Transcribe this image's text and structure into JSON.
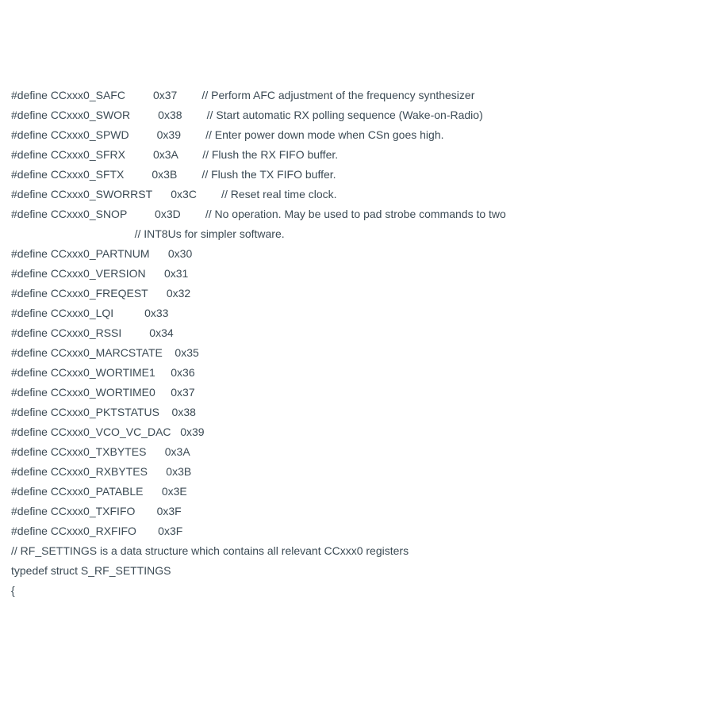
{
  "lines": [
    "#define CCxxx0_SAFC         0x37        // Perform AFC adjustment of the frequency synthesizer",
    "#define CCxxx0_SWOR         0x38        // Start automatic RX polling sequence (Wake-on-Radio)",
    "#define CCxxx0_SPWD         0x39        // Enter power down mode when CSn goes high.",
    "#define CCxxx0_SFRX         0x3A        // Flush the RX FIFO buffer.",
    "#define CCxxx0_SFTX         0x3B        // Flush the TX FIFO buffer.",
    "#define CCxxx0_SWORRST      0x3C        // Reset real time clock.",
    "#define CCxxx0_SNOP         0x3D        // No operation. May be used to pad strobe commands to two",
    "                                        // INT8Us for simpler software.",
    "#define CCxxx0_PARTNUM      0x30",
    "#define CCxxx0_VERSION      0x31",
    "#define CCxxx0_FREQEST      0x32",
    "#define CCxxx0_LQI          0x33",
    "#define CCxxx0_RSSI         0x34",
    "#define CCxxx0_MARCSTATE    0x35",
    "#define CCxxx0_WORTIME1     0x36",
    "#define CCxxx0_WORTIME0     0x37",
    "#define CCxxx0_PKTSTATUS    0x38",
    "#define CCxxx0_VCO_VC_DAC   0x39",
    "#define CCxxx0_TXBYTES      0x3A",
    "#define CCxxx0_RXBYTES      0x3B",
    "#define CCxxx0_PATABLE      0x3E",
    "#define CCxxx0_TXFIFO       0x3F",
    "#define CCxxx0_RXFIFO       0x3F",
    "// RF_SETTINGS is a data structure which contains all relevant CCxxx0 registers",
    "typedef struct S_RF_SETTINGS",
    "{"
  ]
}
